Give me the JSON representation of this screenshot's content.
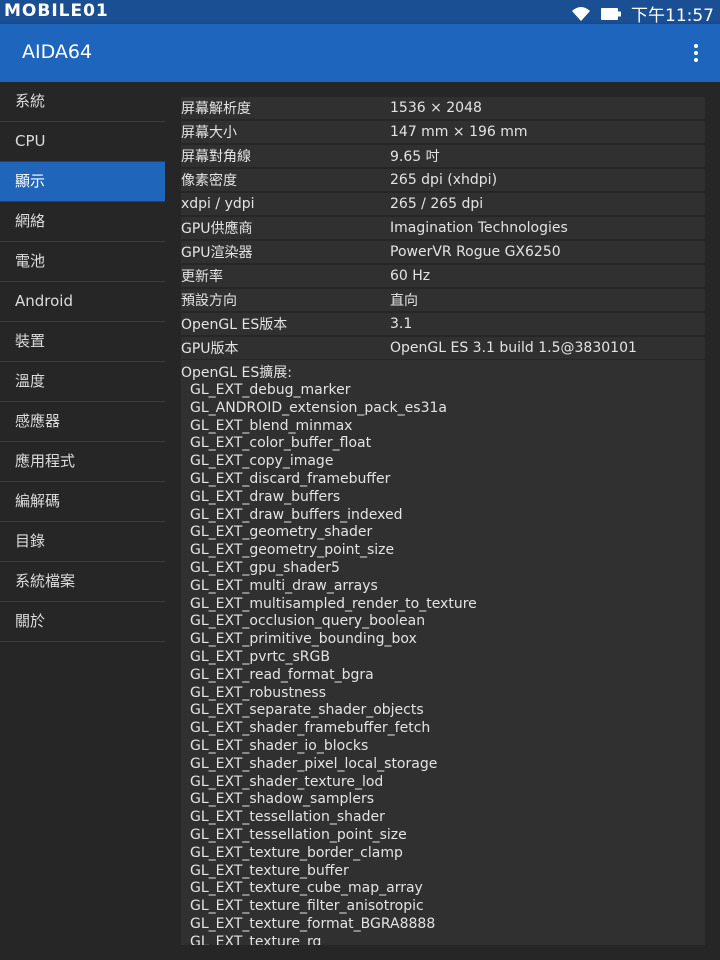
{
  "status_bar": {
    "watermark": "MOBILE01",
    "time": "下午11:57",
    "icons": [
      "wifi-icon",
      "battery-icon"
    ]
  },
  "app_bar": {
    "title": "AIDA64",
    "menu_icon": "overflow-menu-icon"
  },
  "sidebar": {
    "items": [
      {
        "label": "系統"
      },
      {
        "label": "CPU"
      },
      {
        "label": "顯示"
      },
      {
        "label": "網絡"
      },
      {
        "label": "電池"
      },
      {
        "label": "Android"
      },
      {
        "label": "裝置"
      },
      {
        "label": "溫度"
      },
      {
        "label": "感應器"
      },
      {
        "label": "應用程式"
      },
      {
        "label": "編解碼"
      },
      {
        "label": "目錄"
      },
      {
        "label": "系統檔案"
      },
      {
        "label": "關於"
      }
    ],
    "selected": "顯示"
  },
  "display_info": {
    "rows": [
      {
        "key": "屏幕解析度",
        "value": "1536 × 2048"
      },
      {
        "key": "屏幕大小",
        "value": "147 mm × 196 mm"
      },
      {
        "key": "屏幕對角線",
        "value": "9.65 吋"
      },
      {
        "key": "像素密度",
        "value": "265 dpi (xhdpi)"
      },
      {
        "key": "xdpi / ydpi",
        "value": "265 / 265 dpi"
      },
      {
        "key": "GPU供應商",
        "value": "Imagination Technologies"
      },
      {
        "key": "GPU渲染器",
        "value": "PowerVR Rogue GX6250"
      },
      {
        "key": "更新率",
        "value": "60 Hz"
      },
      {
        "key": "預設方向",
        "value": "直向"
      },
      {
        "key": "OpenGL ES版本",
        "value": "3.1"
      },
      {
        "key": "GPU版本",
        "value": "OpenGL ES 3.1 build 1.5@3830101"
      }
    ],
    "extensions_header": "OpenGL ES擴展:",
    "extensions": [
      "GL_EXT_debug_marker",
      "GL_ANDROID_extension_pack_es31a",
      "GL_EXT_blend_minmax",
      "GL_EXT_color_buffer_float",
      "GL_EXT_copy_image",
      "GL_EXT_discard_framebuffer",
      "GL_EXT_draw_buffers",
      "GL_EXT_draw_buffers_indexed",
      "GL_EXT_geometry_shader",
      "GL_EXT_geometry_point_size",
      "GL_EXT_gpu_shader5",
      "GL_EXT_multi_draw_arrays",
      "GL_EXT_multisampled_render_to_texture",
      "GL_EXT_occlusion_query_boolean",
      "GL_EXT_primitive_bounding_box",
      "GL_EXT_pvrtc_sRGB",
      "GL_EXT_read_format_bgra",
      "GL_EXT_robustness",
      "GL_EXT_separate_shader_objects",
      "GL_EXT_shader_framebuffer_fetch",
      "GL_EXT_shader_io_blocks",
      "GL_EXT_shader_pixel_local_storage",
      "GL_EXT_shader_texture_lod",
      "GL_EXT_shadow_samplers",
      "GL_EXT_tessellation_shader",
      "GL_EXT_tessellation_point_size",
      "GL_EXT_texture_border_clamp",
      "GL_EXT_texture_buffer",
      "GL_EXT_texture_cube_map_array",
      "GL_EXT_texture_filter_anisotropic",
      "GL_EXT_texture_format_BGRA8888",
      "GL_EXT_texture_rg"
    ]
  },
  "colors": {
    "status_bar": "#1a4f93",
    "app_bar": "#1e66bd",
    "selected_item": "#1f66bb",
    "background": "#262626",
    "row_background": "#303030"
  }
}
